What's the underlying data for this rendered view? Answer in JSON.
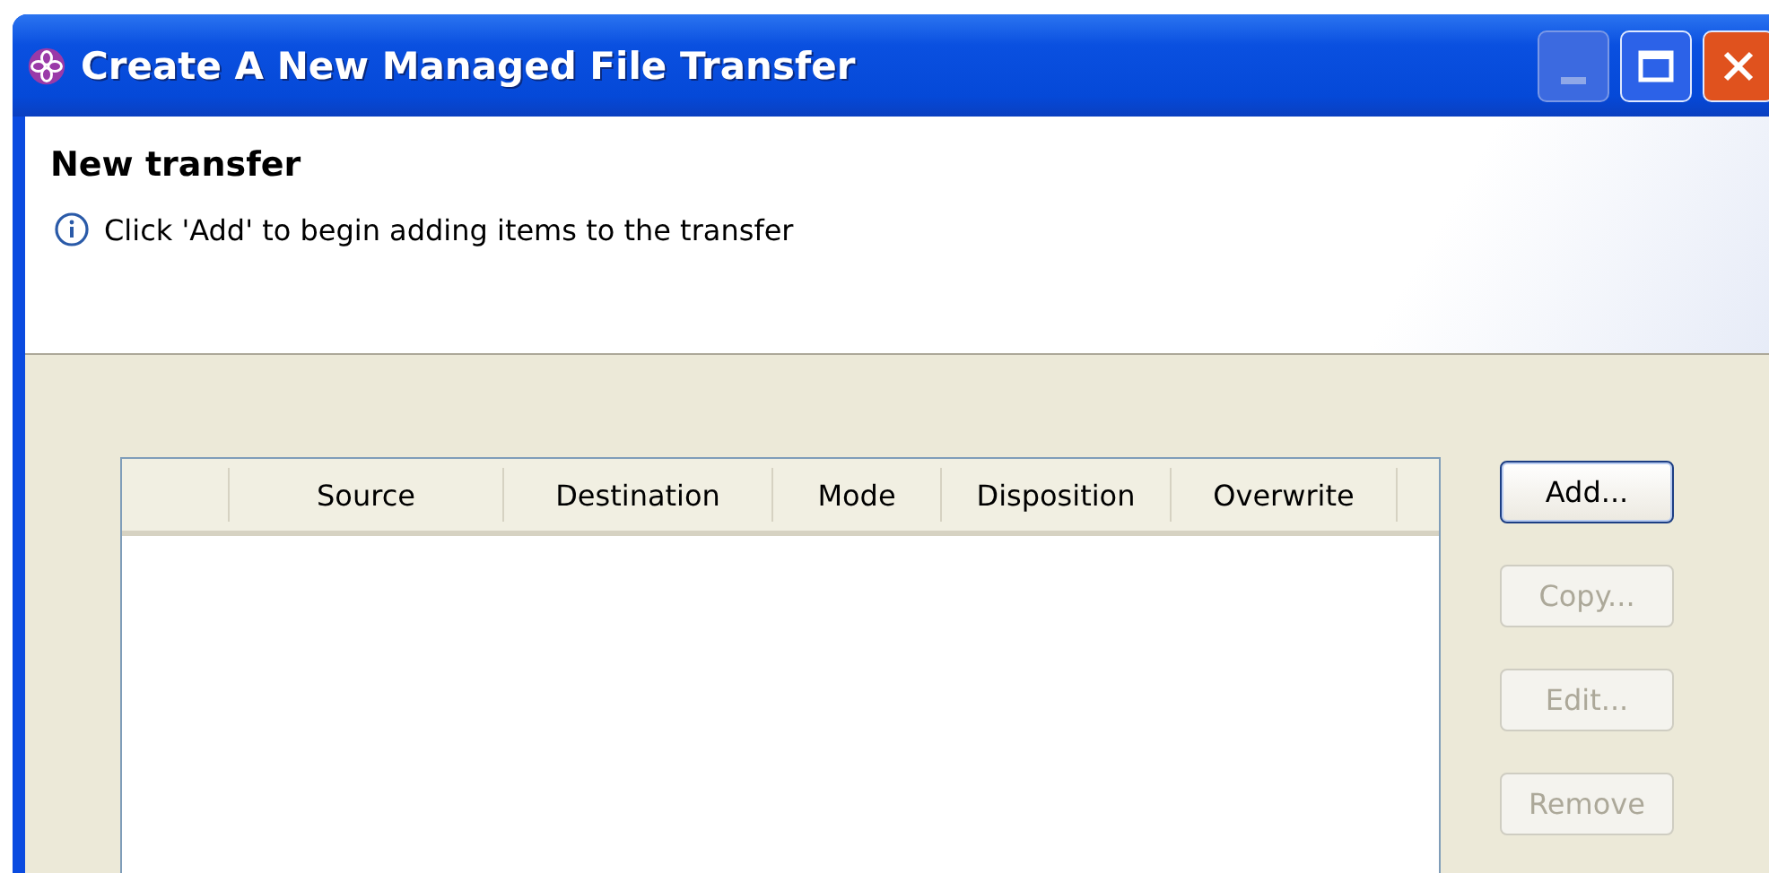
{
  "window": {
    "title": "Create A New Managed File Transfer"
  },
  "header": {
    "title": "New transfer",
    "message": "Click 'Add' to begin adding items to the transfer"
  },
  "table": {
    "columns": [
      "",
      "Source",
      "Destination",
      "Mode",
      "Disposition",
      "Overwrite"
    ]
  },
  "buttons": [
    {
      "label": "Add...",
      "disabled": false,
      "selected": true
    },
    {
      "label": "Copy...",
      "disabled": true,
      "selected": false
    },
    {
      "label": "Edit...",
      "disabled": true,
      "selected": false
    },
    {
      "label": "Remove",
      "disabled": true,
      "selected": false
    }
  ]
}
